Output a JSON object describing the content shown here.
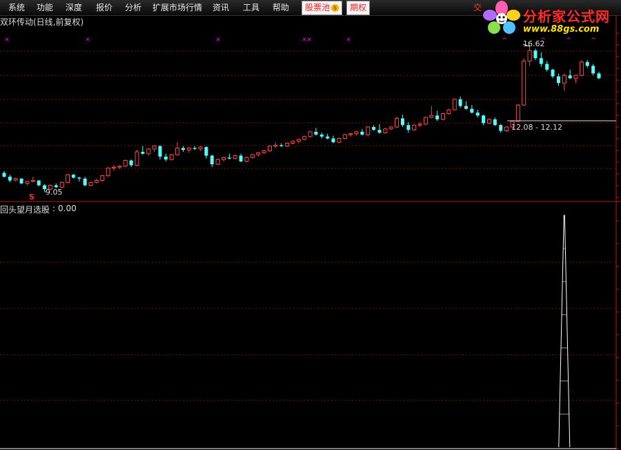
{
  "menu": [
    "系统",
    "功能",
    "深度",
    "报价",
    "分析",
    "扩展市场行情",
    "资讯",
    "工具",
    "帮助"
  ],
  "menu_highlight": {
    "stock_pool": "股票池",
    "coin": "$",
    "options": "期权"
  },
  "partial_menu": "交",
  "logo": {
    "title": "分析家公式网",
    "url": "www.88gs.com"
  },
  "chart_title": "双环传动(日线,前复权)",
  "annotations": {
    "high": "16.62",
    "low": "9.05",
    "date_range": "12.08 - 12.12",
    "low_marker": "S"
  },
  "indicator": {
    "name": "回头望月选股",
    "colon": ":",
    "value": "0.00"
  },
  "colors": {
    "up": "#ff4a4a",
    "down": "#54ffff",
    "grid": "#7a1010",
    "marker": "#ff00ff"
  },
  "chart_data": {
    "type": "candlestick",
    "series": "daily OHLC (approximate, read from image)",
    "ylim": [
      8.5,
      17.6
    ],
    "ohlc": [
      [
        10.0,
        10.1,
        9.75,
        9.8
      ],
      [
        9.8,
        9.9,
        9.5,
        9.6
      ],
      [
        9.62,
        9.75,
        9.55,
        9.7
      ],
      [
        9.7,
        9.72,
        9.4,
        9.45
      ],
      [
        9.45,
        9.6,
        9.35,
        9.55
      ],
      [
        9.55,
        9.8,
        9.5,
        9.6
      ],
      [
        9.6,
        9.62,
        9.3,
        9.35
      ],
      [
        9.35,
        9.4,
        9.05,
        9.15
      ],
      [
        9.15,
        9.4,
        9.1,
        9.35
      ],
      [
        9.35,
        9.45,
        9.2,
        9.25
      ],
      [
        9.25,
        9.55,
        9.2,
        9.5
      ],
      [
        9.5,
        9.95,
        9.45,
        9.9
      ],
      [
        9.9,
        9.95,
        9.7,
        9.75
      ],
      [
        9.75,
        9.8,
        9.55,
        9.7
      ],
      [
        9.7,
        9.8,
        9.3,
        9.35
      ],
      [
        9.35,
        9.55,
        9.3,
        9.5
      ],
      [
        9.5,
        9.7,
        9.45,
        9.6
      ],
      [
        9.6,
        9.9,
        9.55,
        9.85
      ],
      [
        9.85,
        10.3,
        9.8,
        10.25
      ],
      [
        10.25,
        10.4,
        10.1,
        10.3
      ],
      [
        10.3,
        10.4,
        10.2,
        10.35
      ],
      [
        10.35,
        10.7,
        10.3,
        10.65
      ],
      [
        10.65,
        10.7,
        10.3,
        10.4
      ],
      [
        10.4,
        11.2,
        10.35,
        11.1
      ],
      [
        11.1,
        11.4,
        10.95,
        11.0
      ],
      [
        11.0,
        11.3,
        10.9,
        11.25
      ],
      [
        11.25,
        11.45,
        11.1,
        11.4
      ],
      [
        11.4,
        11.45,
        10.7,
        10.85
      ],
      [
        10.85,
        11.0,
        10.6,
        10.7
      ],
      [
        10.7,
        11.0,
        10.65,
        10.95
      ],
      [
        10.95,
        11.6,
        10.9,
        11.3
      ],
      [
        11.3,
        11.4,
        11.1,
        11.2
      ],
      [
        11.2,
        11.35,
        11.05,
        11.3
      ],
      [
        11.3,
        11.4,
        11.2,
        11.25
      ],
      [
        11.25,
        11.4,
        11.15,
        11.35
      ],
      [
        11.35,
        11.4,
        10.75,
        10.9
      ],
      [
        10.9,
        10.95,
        10.3,
        10.45
      ],
      [
        10.45,
        10.75,
        10.4,
        10.7
      ],
      [
        10.7,
        10.85,
        10.6,
        10.8
      ],
      [
        10.8,
        11.0,
        10.7,
        10.75
      ],
      [
        10.75,
        10.95,
        10.7,
        10.9
      ],
      [
        10.9,
        11.0,
        10.55,
        10.6
      ],
      [
        10.6,
        10.85,
        10.55,
        10.8
      ],
      [
        10.8,
        11.0,
        10.75,
        10.95
      ],
      [
        10.95,
        11.1,
        10.85,
        11.05
      ],
      [
        11.05,
        11.2,
        11.0,
        11.15
      ],
      [
        11.15,
        11.45,
        11.1,
        11.4
      ],
      [
        11.4,
        11.6,
        11.3,
        11.45
      ],
      [
        11.45,
        11.55,
        11.35,
        11.4
      ],
      [
        11.4,
        11.6,
        11.35,
        11.55
      ],
      [
        11.55,
        11.7,
        11.5,
        11.65
      ],
      [
        11.65,
        11.8,
        11.55,
        11.75
      ],
      [
        11.75,
        11.95,
        11.7,
        11.9
      ],
      [
        11.9,
        12.2,
        11.85,
        12.15
      ],
      [
        12.15,
        12.35,
        11.95,
        12.0
      ],
      [
        12.0,
        12.1,
        11.8,
        11.9
      ],
      [
        11.9,
        12.05,
        11.75,
        11.8
      ],
      [
        11.8,
        11.95,
        11.55,
        11.6
      ],
      [
        11.6,
        11.85,
        11.55,
        11.8
      ],
      [
        11.8,
        12.05,
        11.75,
        12.0
      ],
      [
        12.0,
        12.1,
        11.9,
        12.05
      ],
      [
        12.05,
        12.2,
        11.95,
        12.15
      ],
      [
        12.15,
        12.3,
        11.95,
        12.0
      ],
      [
        12.0,
        12.45,
        11.9,
        12.4
      ],
      [
        12.4,
        12.5,
        12.2,
        12.25
      ],
      [
        12.25,
        12.55,
        12.05,
        12.1
      ],
      [
        12.1,
        12.35,
        12.05,
        12.3
      ],
      [
        12.3,
        12.45,
        12.25,
        12.4
      ],
      [
        12.4,
        12.95,
        12.35,
        12.85
      ],
      [
        12.85,
        13.05,
        12.4,
        12.5
      ],
      [
        12.5,
        12.65,
        12.1,
        12.25
      ],
      [
        12.25,
        12.55,
        12.2,
        12.5
      ],
      [
        12.5,
        12.65,
        12.4,
        12.55
      ],
      [
        12.55,
        12.95,
        12.5,
        12.9
      ],
      [
        12.9,
        13.5,
        12.85,
        13.0
      ],
      [
        13.0,
        13.25,
        12.7,
        12.8
      ],
      [
        12.8,
        13.15,
        12.75,
        13.1
      ],
      [
        13.1,
        13.35,
        13.05,
        13.3
      ],
      [
        13.3,
        13.9,
        13.25,
        13.85
      ],
      [
        13.85,
        14.0,
        13.4,
        13.5
      ],
      [
        13.5,
        13.75,
        13.3,
        13.35
      ],
      [
        13.35,
        13.55,
        13.1,
        13.15
      ],
      [
        13.15,
        13.3,
        12.9,
        13.0
      ],
      [
        13.0,
        13.05,
        12.5,
        12.6
      ],
      [
        12.6,
        12.85,
        12.55,
        12.8
      ],
      [
        12.8,
        12.9,
        12.45,
        12.5
      ],
      [
        12.5,
        12.55,
        12.1,
        12.2
      ],
      [
        12.2,
        12.45,
        12.15,
        12.4
      ],
      [
        12.4,
        12.75,
        12.3,
        12.7
      ],
      [
        12.7,
        13.6,
        12.65,
        13.55
      ],
      [
        13.55,
        16.0,
        13.5,
        15.85
      ],
      [
        15.85,
        16.62,
        15.6,
        16.4
      ],
      [
        16.4,
        16.5,
        15.9,
        16.0
      ],
      [
        16.0,
        16.3,
        15.55,
        15.7
      ],
      [
        15.7,
        15.85,
        15.3,
        15.4
      ],
      [
        15.4,
        15.45,
        14.95,
        15.05
      ],
      [
        15.05,
        15.2,
        14.55,
        14.7
      ],
      [
        14.7,
        15.2,
        14.3,
        15.1
      ],
      [
        15.1,
        15.4,
        14.9,
        14.95
      ],
      [
        14.95,
        15.15,
        14.7,
        15.1
      ],
      [
        15.1,
        15.9,
        15.05,
        15.8
      ],
      [
        15.8,
        15.9,
        15.5,
        15.6
      ],
      [
        15.6,
        15.7,
        15.1,
        15.2
      ],
      [
        15.2,
        15.3,
        14.9,
        14.95
      ]
    ],
    "indicator_series": {
      "name": "回头望月选股",
      "value_min": 0,
      "value_max": 1,
      "signal_bar_index": 97,
      "signal_value": 1
    }
  }
}
